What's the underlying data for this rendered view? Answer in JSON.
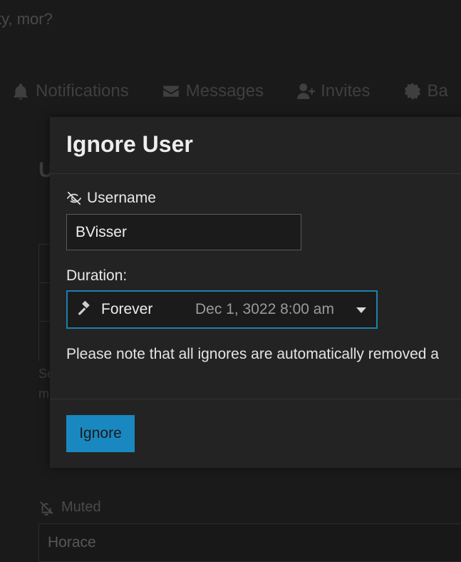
{
  "background": {
    "greeting": "ty, mor?",
    "nav": [
      {
        "label": "Notifications",
        "icon": "bell-icon"
      },
      {
        "label": "Messages",
        "icon": "envelope-icon"
      },
      {
        "label": "Invites",
        "icon": "user-plus-icon"
      },
      {
        "label": "Ba",
        "icon": "badge-icon"
      }
    ],
    "heading": "U",
    "frag1": "Se",
    "frag2": "m",
    "muted_label": "Muted",
    "muted_value": "Horace"
  },
  "dialog": {
    "title": "Ignore User",
    "username_label": "Username",
    "username_value": "BVisser",
    "duration_label": "Duration:",
    "duration_value": "Forever",
    "duration_date": "Dec 1, 3022 8:00 am",
    "note": "Please note that all ignores are automatically removed a",
    "ignore_button": "Ignore"
  },
  "colors": {
    "accent": "#1a88c0",
    "focus_border": "#1d7fae"
  }
}
